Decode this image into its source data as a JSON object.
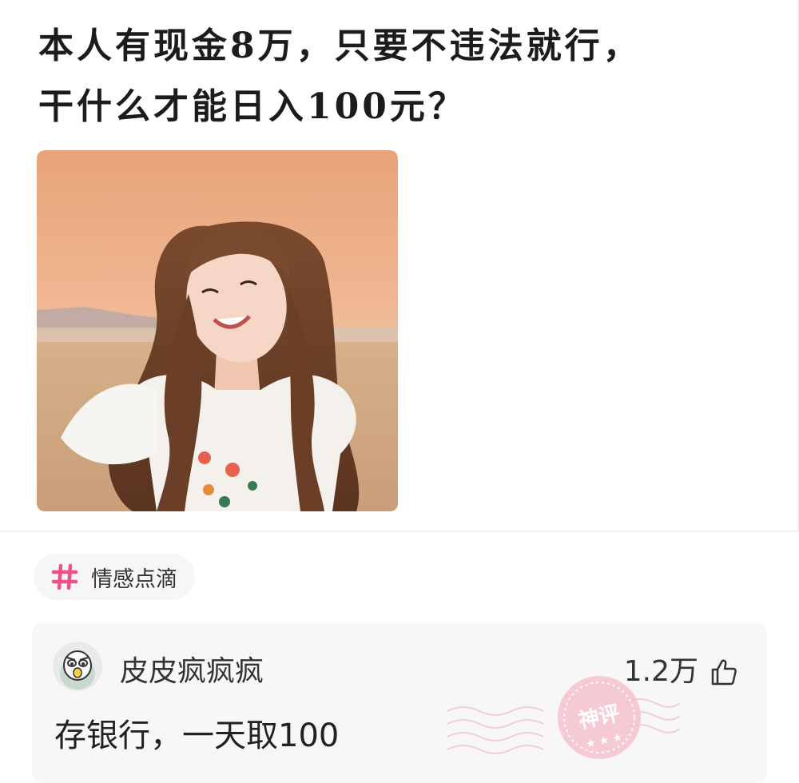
{
  "post": {
    "title_line1": "本人有现金8万，只要不违法就行，",
    "title_line2": "干什么才能日入100元？"
  },
  "topic": {
    "icon": "hash-icon",
    "label": "情感点滴",
    "accent": "#f0508a"
  },
  "comment": {
    "user_name": "皮皮疯疯疯",
    "like_count": "1.2万",
    "text": "存银行，一天取100",
    "badge_label": "神评"
  },
  "colors": {
    "tag_bg": "#f6f6f6",
    "comment_bg": "#f7f7f7",
    "stamp": "#f2a3b8"
  }
}
